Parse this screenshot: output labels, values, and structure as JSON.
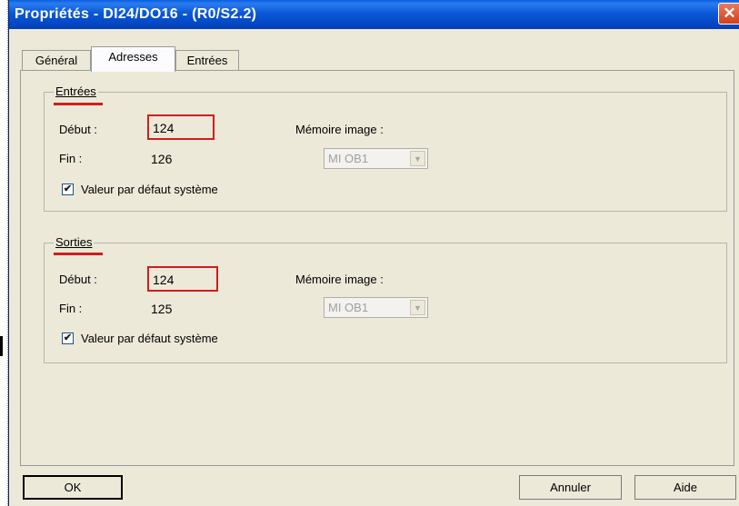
{
  "window": {
    "title": "Propriétés - DI24/DO16 - (R0/S2.2)",
    "close_glyph": "✕"
  },
  "tabs": [
    {
      "label": "Général",
      "active": false
    },
    {
      "label": "Adresses",
      "active": true
    },
    {
      "label": "Entrées",
      "active": false
    }
  ],
  "entrees": {
    "legend": "Entrées",
    "debut_label": "Début :",
    "debut_value": "124",
    "fin_label": "Fin :",
    "fin_value": "126",
    "memoire_label": "Mémoire image :",
    "memoire_value": "MI OB1",
    "checkbox_label": "Valeur par défaut système",
    "checkbox_checked": true
  },
  "sorties": {
    "legend": "Sorties",
    "debut_label": "Début :",
    "debut_value": "124",
    "fin_label": "Fin :",
    "fin_value": "125",
    "memoire_label": "Mémoire image :",
    "memoire_value": "MI OB1",
    "checkbox_label": "Valeur par défaut système",
    "checkbox_checked": true
  },
  "buttons": {
    "ok": "OK",
    "annuler": "Annuler",
    "aide": "Aide"
  },
  "colors": {
    "titlebar": "#0a58d6",
    "dialog_bg": "#ece9d8",
    "highlight": "#d11d1d",
    "close": "#d1401c"
  },
  "icons": {
    "checkmark": "✔",
    "dropdown_arrow": "▼"
  }
}
